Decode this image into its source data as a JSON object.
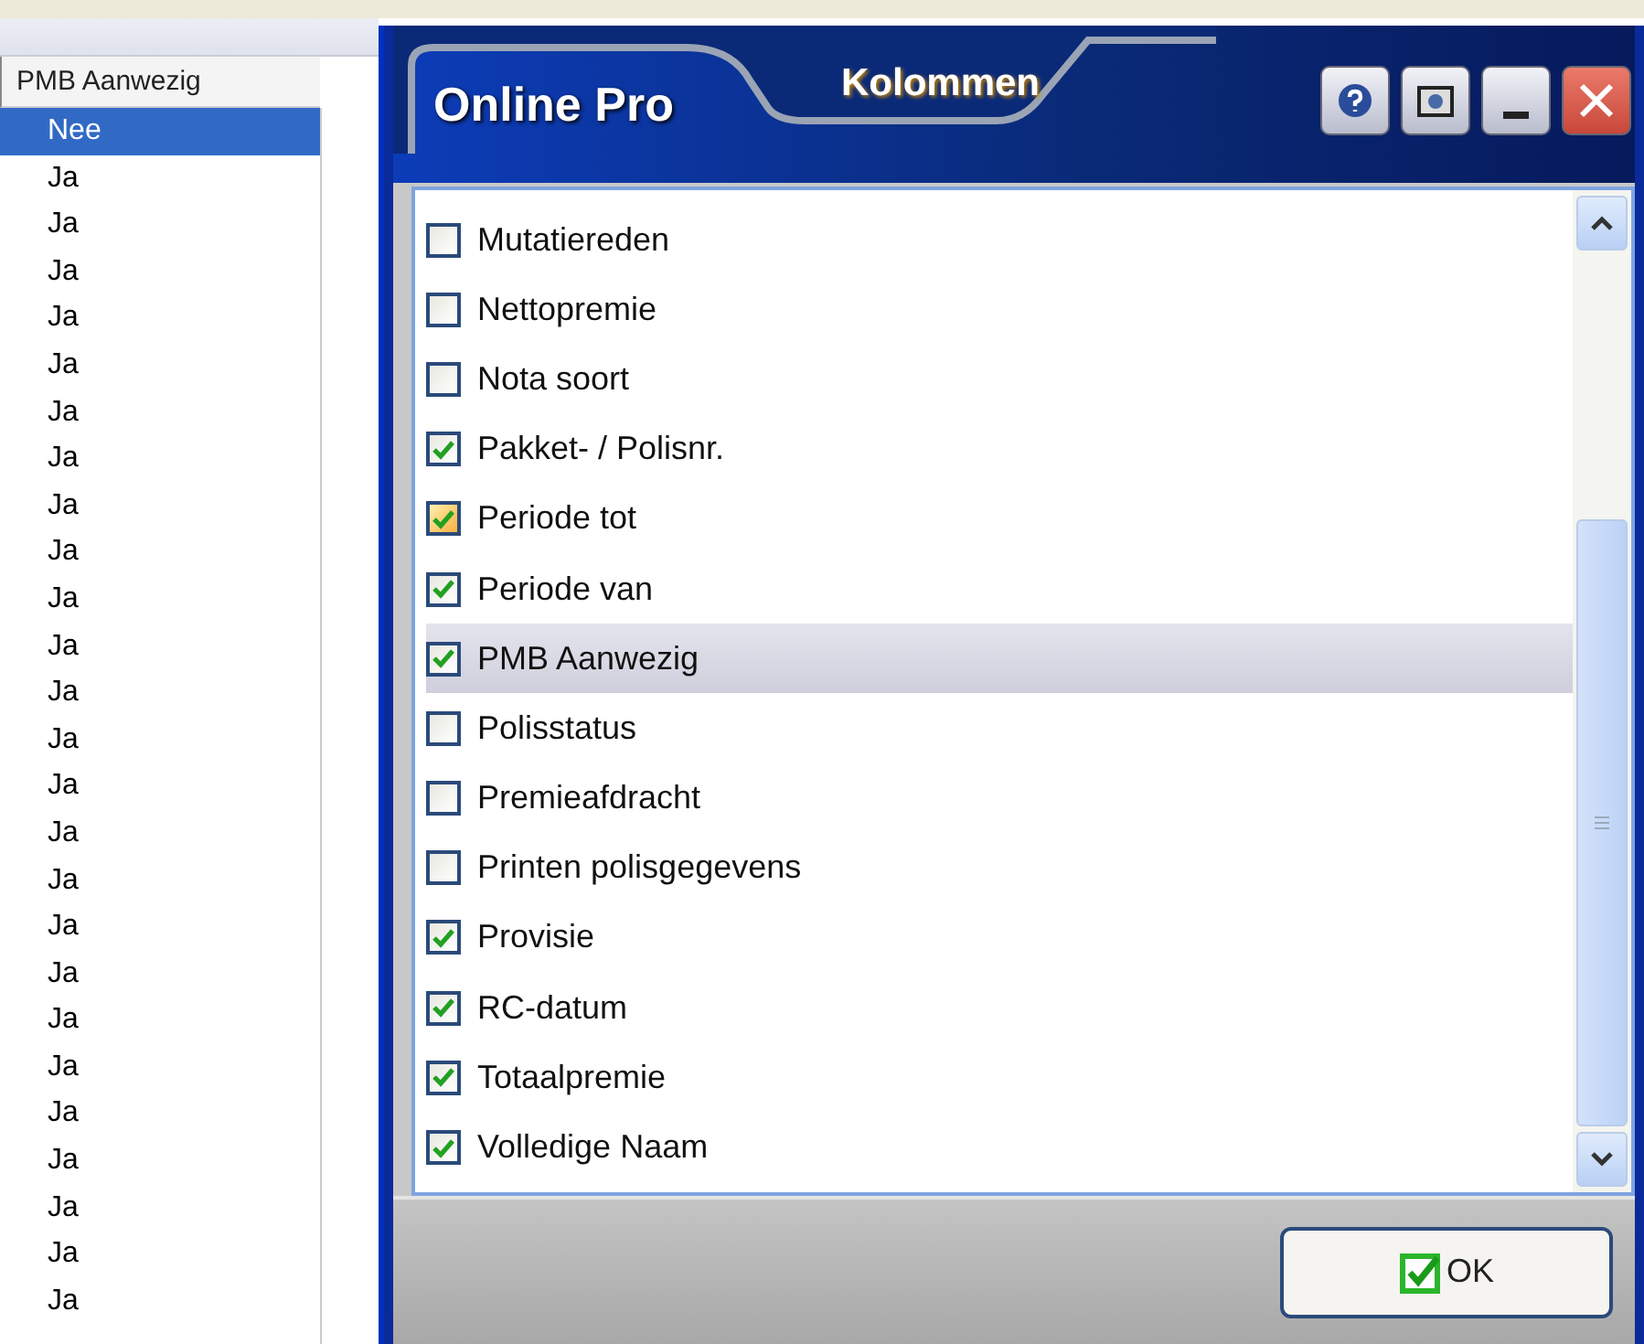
{
  "background_list": {
    "column": "PMB Aanwezig",
    "rows": [
      {
        "value": "Nee",
        "selected": true
      },
      {
        "value": "Ja",
        "selected": false
      },
      {
        "value": "Ja",
        "selected": false
      },
      {
        "value": "Ja",
        "selected": false
      },
      {
        "value": "Ja",
        "selected": false
      },
      {
        "value": "Ja",
        "selected": false
      },
      {
        "value": "Ja",
        "selected": false
      },
      {
        "value": "Ja",
        "selected": false
      },
      {
        "value": "Ja",
        "selected": false
      },
      {
        "value": "Ja",
        "selected": false
      },
      {
        "value": "Ja",
        "selected": false
      },
      {
        "value": "Ja",
        "selected": false
      },
      {
        "value": "Ja",
        "selected": false
      },
      {
        "value": "Ja",
        "selected": false
      },
      {
        "value": "Ja",
        "selected": false
      },
      {
        "value": "Ja",
        "selected": false
      },
      {
        "value": "Ja",
        "selected": false
      },
      {
        "value": "Ja",
        "selected": false
      },
      {
        "value": "Ja",
        "selected": false
      },
      {
        "value": "Ja",
        "selected": false
      },
      {
        "value": "Ja",
        "selected": false
      },
      {
        "value": "Ja",
        "selected": false
      },
      {
        "value": "Ja",
        "selected": false
      },
      {
        "value": "Ja",
        "selected": false
      },
      {
        "value": "Ja",
        "selected": false
      },
      {
        "value": "Ja",
        "selected": false
      }
    ]
  },
  "dialog": {
    "app_name": "Online Pro",
    "title": "Kolommen",
    "columns": [
      {
        "label": "Mutatiereden",
        "checked": false,
        "hovered": false,
        "selected": false
      },
      {
        "label": "Nettopremie",
        "checked": false,
        "hovered": false,
        "selected": false
      },
      {
        "label": "Nota soort",
        "checked": false,
        "hovered": false,
        "selected": false
      },
      {
        "label": "Pakket- / Polisnr.",
        "checked": true,
        "hovered": false,
        "selected": false
      },
      {
        "label": "Periode tot",
        "checked": true,
        "hovered": true,
        "selected": false
      },
      {
        "label": "Periode van",
        "checked": true,
        "hovered": false,
        "selected": false
      },
      {
        "label": "PMB Aanwezig",
        "checked": true,
        "hovered": false,
        "selected": true
      },
      {
        "label": "Polisstatus",
        "checked": false,
        "hovered": false,
        "selected": false
      },
      {
        "label": "Premieafdracht",
        "checked": false,
        "hovered": false,
        "selected": false
      },
      {
        "label": "Printen polisgegevens",
        "checked": false,
        "hovered": false,
        "selected": false
      },
      {
        "label": "Provisie",
        "checked": true,
        "hovered": false,
        "selected": false
      },
      {
        "label": "RC-datum",
        "checked": true,
        "hovered": false,
        "selected": false
      },
      {
        "label": "Totaalpremie",
        "checked": true,
        "hovered": false,
        "selected": false
      },
      {
        "label": "Volledige Naam",
        "checked": true,
        "hovered": false,
        "selected": false
      }
    ],
    "ok_button": "OK"
  }
}
